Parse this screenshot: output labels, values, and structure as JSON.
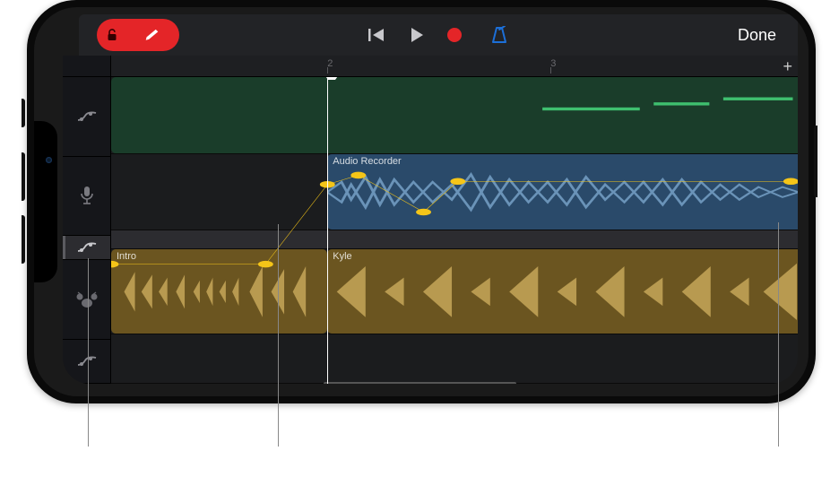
{
  "toolbar": {
    "done_label": "Done"
  },
  "ruler": {
    "ticks": [
      {
        "pos": "31.5%",
        "label": "2"
      },
      {
        "pos": "64%",
        "label": "3"
      }
    ],
    "add_label": "+"
  },
  "tracks": {
    "green": {
      "label": ""
    },
    "audio": {
      "label": "Audio Recorder"
    },
    "drums_a": {
      "label": "Intro"
    },
    "drums_b": {
      "label": "Kyle"
    }
  },
  "automation_points": [
    {
      "x": 0.0,
      "y": 0.61
    },
    {
      "x": 0.225,
      "y": 0.61
    },
    {
      "x": 0.315,
      "y": 0.35
    },
    {
      "x": 0.36,
      "y": 0.32
    },
    {
      "x": 0.455,
      "y": 0.44
    },
    {
      "x": 0.505,
      "y": 0.34
    },
    {
      "x": 0.99,
      "y": 0.34
    },
    {
      "x": 1.02,
      "y": 0.36
    }
  ],
  "colors": {
    "accent_red": "#e42528",
    "accent_blue": "#1c6fd8",
    "automation": "#f5c518"
  },
  "icons": {
    "lock": "lock-open",
    "edit": "pencil",
    "rewind": "skip-back",
    "play": "play",
    "record": "record-dot",
    "metronome": "metronome",
    "automation": "automation-curve",
    "mic": "microphone",
    "drums": "drum-kit"
  }
}
